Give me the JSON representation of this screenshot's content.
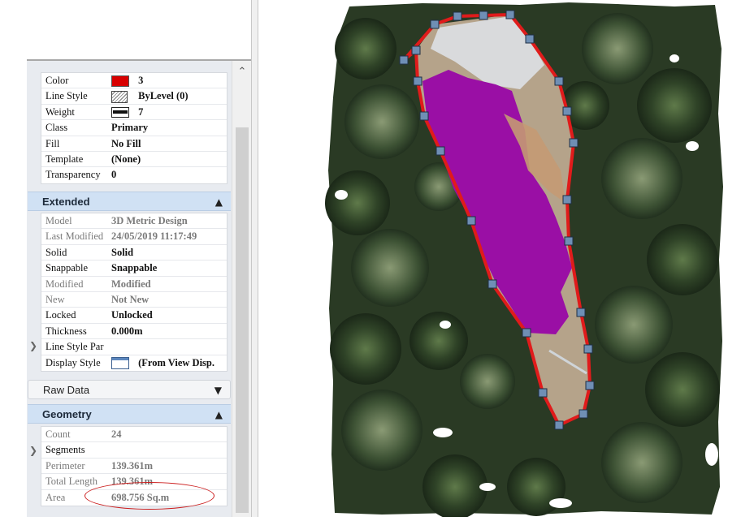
{
  "symbology": {
    "rows": [
      {
        "label": "Color",
        "value": "3",
        "icon": "color-swatch-icon",
        "swatch": "#d80000"
      },
      {
        "label": "Line Style",
        "value": "ByLevel (0)",
        "icon": "line-style-icon"
      },
      {
        "label": "Weight",
        "value": "7",
        "icon": "line-weight-icon"
      },
      {
        "label": "Class",
        "value": "Primary"
      },
      {
        "label": "Fill",
        "value": "No Fill"
      },
      {
        "label": "Template",
        "value": "(None)"
      },
      {
        "label": "Transparency",
        "value": "0"
      }
    ]
  },
  "extended": {
    "title": "Extended",
    "rows": [
      {
        "label": "Model",
        "value": "3D Metric Design"
      },
      {
        "label": "Last Modified",
        "value": "24/05/2019 11:17:49"
      },
      {
        "label": "Solid",
        "value": "Solid"
      },
      {
        "label": "Snappable",
        "value": "Snappable"
      },
      {
        "label": "Modified",
        "value": "Modified"
      },
      {
        "label": "New",
        "value": "Not New"
      },
      {
        "label": "Locked",
        "value": "Unlocked"
      },
      {
        "label": "Thickness",
        "value": "0.000m"
      },
      {
        "label": "Line Style Par",
        "value": ""
      },
      {
        "label": "Display Style",
        "value": "(From View Disp.",
        "icon": "display-style-icon"
      }
    ]
  },
  "raw_data": {
    "title": "Raw Data"
  },
  "geometry": {
    "title": "Geometry",
    "rows": [
      {
        "label": "Count",
        "value": "24"
      },
      {
        "label": "Segments",
        "value": ""
      },
      {
        "label": "Perimeter",
        "value": "139.361m"
      },
      {
        "label": "Total Length",
        "value": "139.361m"
      },
      {
        "label": "Area",
        "value": "698.756 Sq.m"
      }
    ]
  },
  "colors": {
    "boundary": "#e01b1b",
    "highlight_fill": "#9a0fa5",
    "vertex": "#6f8fb5",
    "annotation_circle": "#cc1f1f",
    "section_header": "#d0e1f4"
  }
}
